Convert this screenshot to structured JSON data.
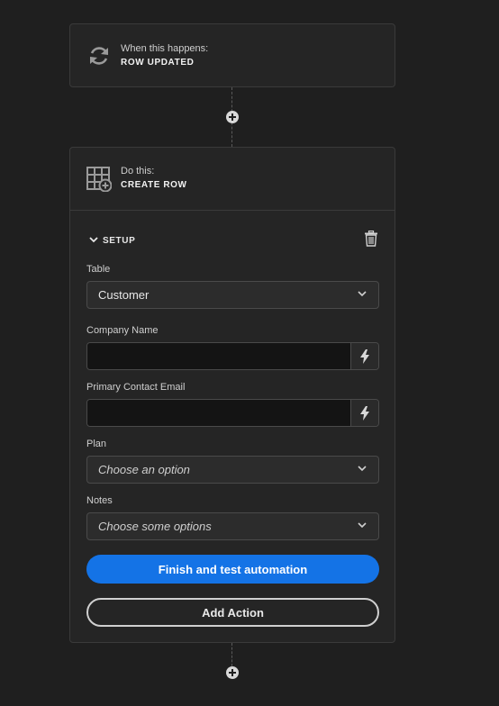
{
  "trigger": {
    "subtitle": "When this happens:",
    "name": "ROW UPDATED",
    "icon": "refresh-icon"
  },
  "action": {
    "subtitle": "Do this:",
    "name": "CREATE ROW",
    "icon": "table-add-icon",
    "setup_label": "SETUP",
    "fields": {
      "table": {
        "label": "Table",
        "value": "Customer"
      },
      "company_name": {
        "label": "Company Name",
        "value": ""
      },
      "primary_contact_email": {
        "label": "Primary Contact Email",
        "value": ""
      },
      "plan": {
        "label": "Plan",
        "placeholder": "Choose an option"
      },
      "notes": {
        "label": "Notes",
        "placeholder": "Choose some options"
      }
    },
    "finish_button": "Finish and test automation",
    "add_action_button": "Add Action"
  },
  "colors": {
    "background": "#1f1f1f",
    "card": "#252525",
    "primary": "#1473e6"
  }
}
